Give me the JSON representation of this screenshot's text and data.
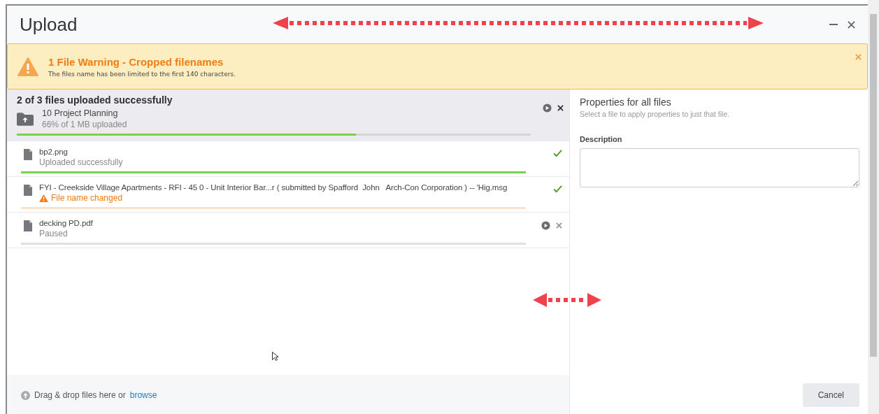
{
  "window": {
    "title": "Upload"
  },
  "warning": {
    "title": "1 File Warning - Cropped filenames",
    "message": "The files name has been limited to the first 140 characters."
  },
  "summary": {
    "heading": "2 of 3 files uploaded successfully",
    "folder": "10 Project Planning",
    "progress_text": "66% of 1 MB uploaded",
    "level": 0.66
  },
  "files": [
    {
      "name": "bp2.png",
      "status": "Uploaded successfully",
      "kind": "success",
      "level": 1
    },
    {
      "name": "FYI - Creekside Village Apartments - RFI - 45 0 - Unit Interior Bar...r ( submitted by Spafford  John   Arch-Con Corporation ) -- 'Hig.msg",
      "status": "File name changed",
      "kind": "warning",
      "level": 1
    },
    {
      "name": "decking PD.pdf",
      "status": "Paused",
      "kind": "paused",
      "level": 0
    }
  ],
  "dropzone": {
    "text": "Drag & drop files here or",
    "link": "browse"
  },
  "properties": {
    "title": "Properties for all files",
    "hint": "Select a file to apply properties to just that file.",
    "field_label": "Description"
  },
  "buttons": [
    "Cancel"
  ]
}
